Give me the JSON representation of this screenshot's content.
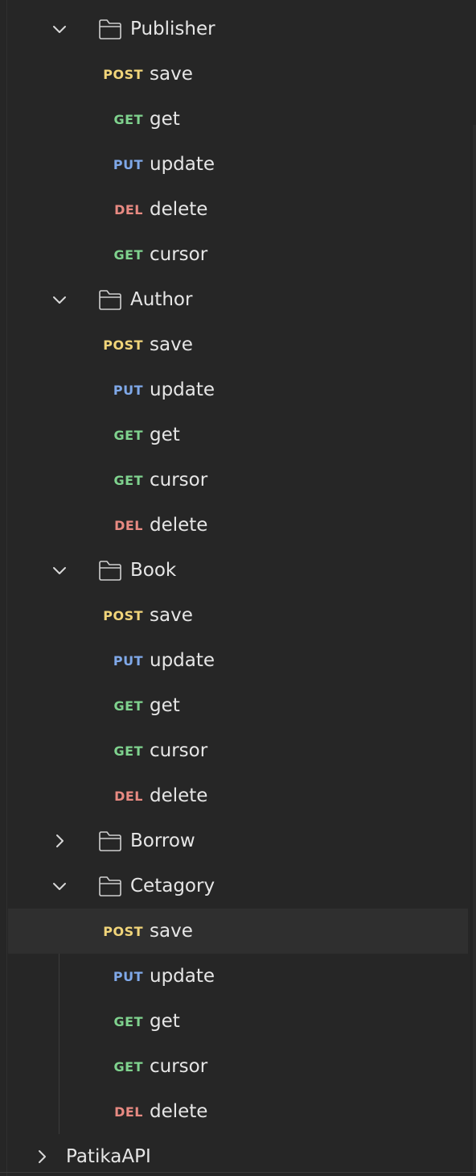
{
  "folders": [
    {
      "name": "Publisher",
      "expanded": true,
      "requests": [
        {
          "method": "POST",
          "name": "save"
        },
        {
          "method": "GET",
          "name": "get"
        },
        {
          "method": "PUT",
          "name": "update"
        },
        {
          "method": "DEL",
          "name": "delete"
        },
        {
          "method": "GET",
          "name": "cursor"
        }
      ]
    },
    {
      "name": "Author",
      "expanded": true,
      "requests": [
        {
          "method": "POST",
          "name": "save"
        },
        {
          "method": "PUT",
          "name": "update"
        },
        {
          "method": "GET",
          "name": "get"
        },
        {
          "method": "GET",
          "name": "cursor"
        },
        {
          "method": "DEL",
          "name": "delete"
        }
      ]
    },
    {
      "name": "Book",
      "expanded": true,
      "requests": [
        {
          "method": "POST",
          "name": "save"
        },
        {
          "method": "PUT",
          "name": "update"
        },
        {
          "method": "GET",
          "name": "get"
        },
        {
          "method": "GET",
          "name": "cursor"
        },
        {
          "method": "DEL",
          "name": "delete"
        }
      ]
    },
    {
      "name": "Borrow",
      "expanded": false,
      "requests": []
    },
    {
      "name": "Cetagory",
      "expanded": true,
      "requests": [
        {
          "method": "POST",
          "name": "save",
          "selected": true
        },
        {
          "method": "PUT",
          "name": "update"
        },
        {
          "method": "GET",
          "name": "get"
        },
        {
          "method": "GET",
          "name": "cursor"
        },
        {
          "method": "DEL",
          "name": "delete"
        }
      ]
    }
  ],
  "collection": {
    "name": "PatikaAPI",
    "expanded": false
  },
  "colors": {
    "background": "#262626",
    "post": "#f1d57a",
    "get": "#7fd28e",
    "put": "#7fa8e8",
    "del": "#e88a82",
    "text": "#e6e6e6"
  },
  "icons": {
    "expanded": "chevron-down-icon",
    "collapsed": "chevron-right-icon",
    "folder": "folder-icon"
  }
}
